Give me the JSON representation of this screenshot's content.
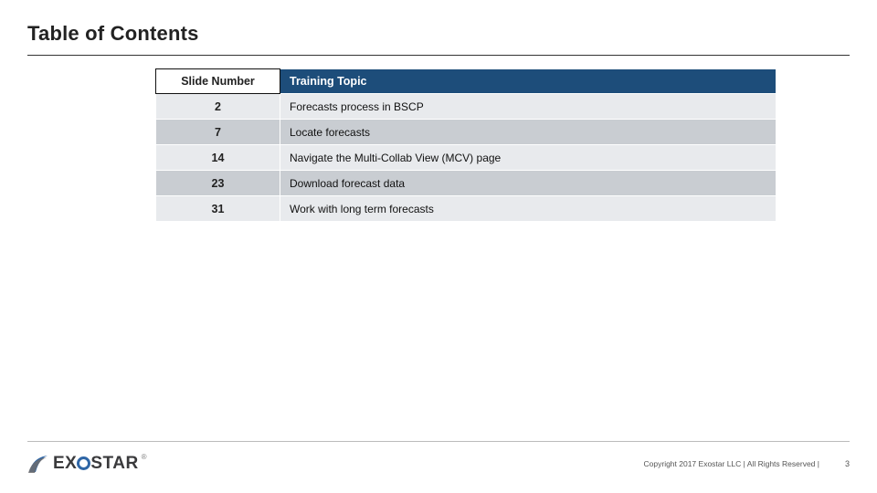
{
  "title": "Table of Contents",
  "table": {
    "headers": {
      "slide": "Slide Number",
      "topic": "Training Topic"
    },
    "rows": [
      {
        "slide": "2",
        "topic": "Forecasts process in BSCP"
      },
      {
        "slide": "7",
        "topic": "Locate forecasts"
      },
      {
        "slide": "14",
        "topic": "Navigate the Multi-Collab View (MCV) page"
      },
      {
        "slide": "23",
        "topic": "Download forecast data"
      },
      {
        "slide": "31",
        "topic": "Work with long term forecasts"
      }
    ]
  },
  "footer": {
    "logo_text_left": "EX",
    "logo_text_right": "STAR",
    "logo_reg": "®",
    "copyright": "Copyright 2017 Exostar LLC | All Rights Reserved |",
    "page": "3"
  },
  "colors": {
    "header_bg": "#1d4d7a",
    "band_light": "#e8eaed",
    "band_dark": "#c9cdd2",
    "logo_accent": "#2f66a6"
  }
}
